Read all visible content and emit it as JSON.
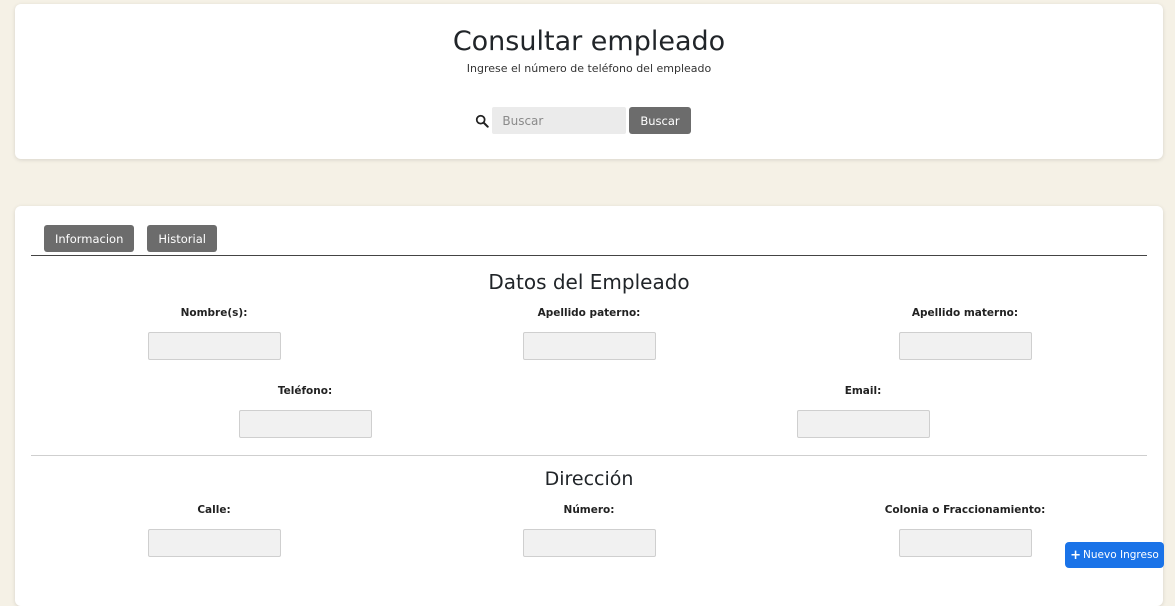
{
  "header": {
    "title": "Consultar empleado",
    "subtitle": "Ingrese el número de teléfono del empleado",
    "search": {
      "placeholder": "Buscar",
      "value": "",
      "button_label": "Buscar"
    }
  },
  "tabs": [
    {
      "label": "Informacion"
    },
    {
      "label": "Historial"
    }
  ],
  "employee_section": {
    "title": "Datos del Empleado",
    "fields": [
      {
        "label": "Nombre(s):",
        "value": ""
      },
      {
        "label": "Apellido paterno:",
        "value": ""
      },
      {
        "label": "Apellido materno:",
        "value": ""
      },
      {
        "label": "Teléfono:",
        "value": ""
      },
      {
        "label": "Email:",
        "value": ""
      }
    ]
  },
  "address_section": {
    "title": "Dirección",
    "fields": [
      {
        "label": "Calle:",
        "value": ""
      },
      {
        "label": "Número:",
        "value": ""
      },
      {
        "label": "Colonia o Fraccionamiento:",
        "value": ""
      }
    ]
  },
  "fab": {
    "icon": "plus-icon",
    "label": "Nuevo Ingreso"
  },
  "colors": {
    "background": "#f5f1e6",
    "card": "#ffffff",
    "button_gray": "#6c6c6c",
    "accent_blue": "#1a73e8",
    "input_bg": "#f1f1f1"
  }
}
